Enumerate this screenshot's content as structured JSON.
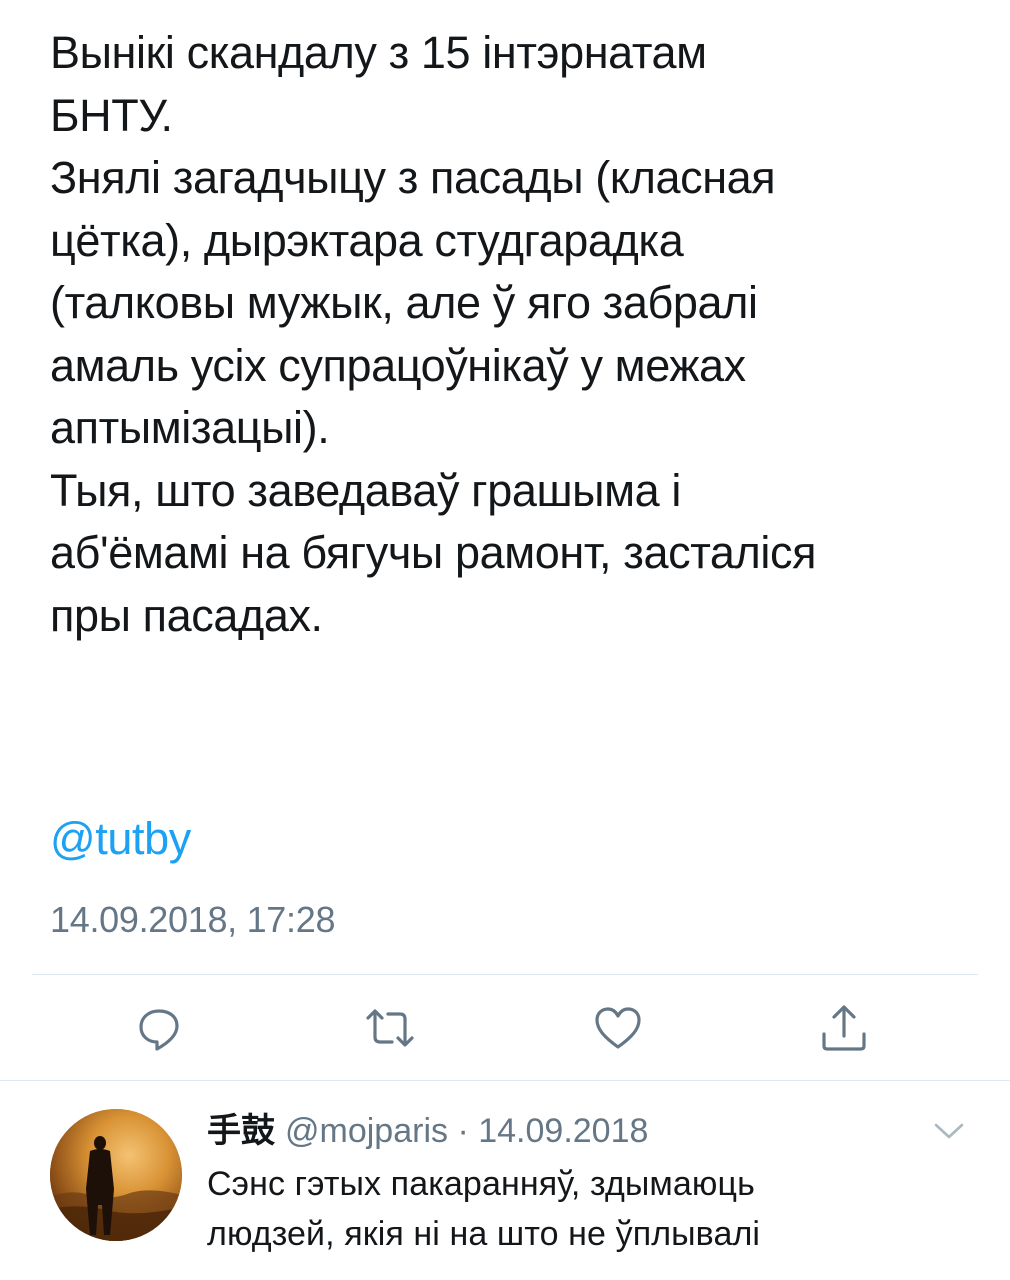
{
  "tweet": {
    "lines": [
      "Вынікі скандалу з 15 інтэрнатам",
      "БНТУ.",
      "Знялі загадчыцу з пасады (класная",
      "цётка), дырэктара студгарадка",
      "(талковы мужык, але ў яго забралі",
      "амаль усіх супрацоўнікаў у межах",
      "аптымізацыі).",
      "Тыя, што заведаваў грашыма і",
      "аб'ёмамі на бягучы рамонт, засталіся",
      "пры пасадах."
    ],
    "mention": "@tutby",
    "timestamp": "14.09.2018, 17:28"
  },
  "actions": {
    "reply_icon": "reply-icon",
    "retweet_icon": "retweet-icon",
    "like_icon": "like-heart-icon",
    "share_icon": "share-icon",
    "icon_color": "#657786"
  },
  "reply": {
    "name": "手鼓",
    "handle": "@mojparis",
    "separator": "·",
    "date": "14.09.2018",
    "lines": [
      "Сэнс гэтых пакаранняў, здымаюць",
      "людзей, якія ні на што не ўплывалі"
    ]
  },
  "colors": {
    "text": "#14171a",
    "link": "#1da1f2",
    "muted": "#657786",
    "divider": "#e1e8ed"
  }
}
